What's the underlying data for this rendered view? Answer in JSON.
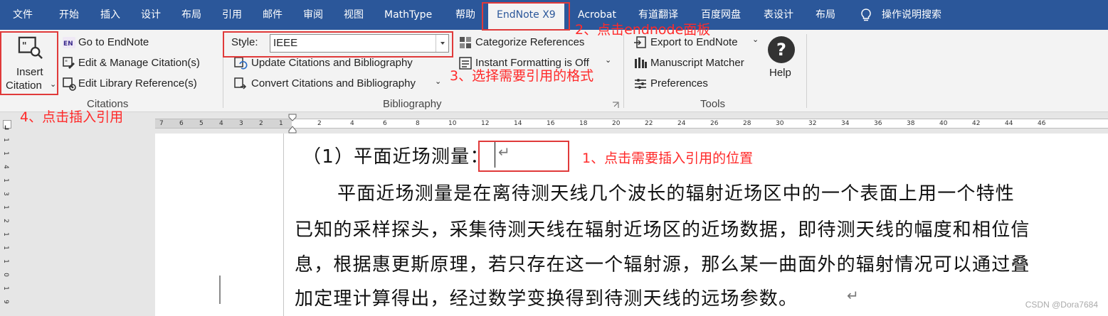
{
  "tabs": {
    "file": "文件",
    "home": "开始",
    "insert": "插入",
    "design": "设计",
    "layout": "布局",
    "references": "引用",
    "mailings": "邮件",
    "review": "审阅",
    "view": "视图",
    "mathtype": "MathType",
    "help": "帮助",
    "endnote": "EndNote X9",
    "acrobat": "Acrobat",
    "youdao": "有道翻译",
    "baidu": "百度网盘",
    "table_design": "表设计",
    "table_layout": "布局",
    "tell_me": "操作说明搜索"
  },
  "ribbon": {
    "citations": {
      "insert_line1": "Insert",
      "insert_line2": "Citation",
      "go_to_endnote": "Go to EndNote",
      "edit_manage": "Edit & Manage Citation(s)",
      "edit_library": "Edit Library Reference(s)",
      "group_label": "Citations"
    },
    "bibliography": {
      "style_label": "Style:",
      "style_value": "IEEE",
      "update": "Update Citations and Bibliography",
      "convert": "Convert Citations and Bibliography",
      "categorize": "Categorize References",
      "instant": "Instant Formatting is Off",
      "group_label": "Bibliography"
    },
    "tools": {
      "export": "Export to EndNote",
      "matcher": "Manuscript Matcher",
      "preferences": "Preferences",
      "help": "Help",
      "group_label": "Tools"
    }
  },
  "ruler": {
    "left_ticks": [
      "7",
      "6",
      "5",
      "4",
      "3",
      "2",
      "1"
    ],
    "right_ticks": [
      "2",
      "4",
      "6",
      "8",
      "10",
      "12",
      "14",
      "16",
      "18",
      "20",
      "22",
      "24",
      "26",
      "28",
      "30",
      "32",
      "34",
      "36",
      "38",
      "40",
      "42",
      "44",
      "46"
    ],
    "vertical": [
      "1",
      "1",
      "4",
      "1",
      "3",
      "1",
      "2",
      "1",
      "1",
      "1",
      "0",
      "1",
      "9"
    ]
  },
  "document": {
    "heading": "（1）平面近场测量：",
    "para_line1": "平面近场测量是在离待测天线几个波长的辐射近场区中的一个表面上用一个特性",
    "para_line2": "已知的采样探头，采集待测天线在辐射近场区的近场数据，即待测天线的幅度和相位信",
    "para_line3": "息，根据惠更斯原理，若只存在这一个辐射源，那么某一曲面外的辐射情况可以通过叠",
    "para_line4": "加定理计算得出，经过数学变换得到待测天线的远场参数。",
    "para_mark": "↵"
  },
  "annotations": {
    "step1": "1、点击需要插入引用的位置",
    "step2": "2、点击endnode面板",
    "step3": "3、选择需要引用的格式",
    "step4": "4、点击插入引用"
  },
  "watermark": "CSDN @Dora7684",
  "colors": {
    "ribbon_tab_bar": "#2b579a",
    "annotation_red": "#ff2a2a"
  }
}
